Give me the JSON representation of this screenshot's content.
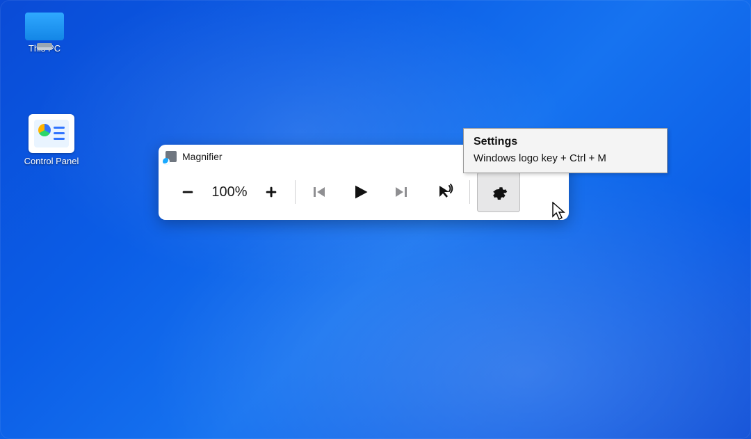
{
  "desktop": {
    "icons": {
      "this_pc": "This PC",
      "control_panel": "Control Panel"
    }
  },
  "magnifier": {
    "title": "Magnifier",
    "zoom_out_label": "Zoom out",
    "zoom_value": "100%",
    "zoom_in_label": "Zoom in",
    "prev_label": "Previous",
    "play_label": "Play",
    "next_label": "Next",
    "read_cursor_label": "Read from cursor",
    "settings_label": "Settings"
  },
  "tooltip": {
    "title": "Settings",
    "shortcut": "Windows logo key + Ctrl + M"
  }
}
